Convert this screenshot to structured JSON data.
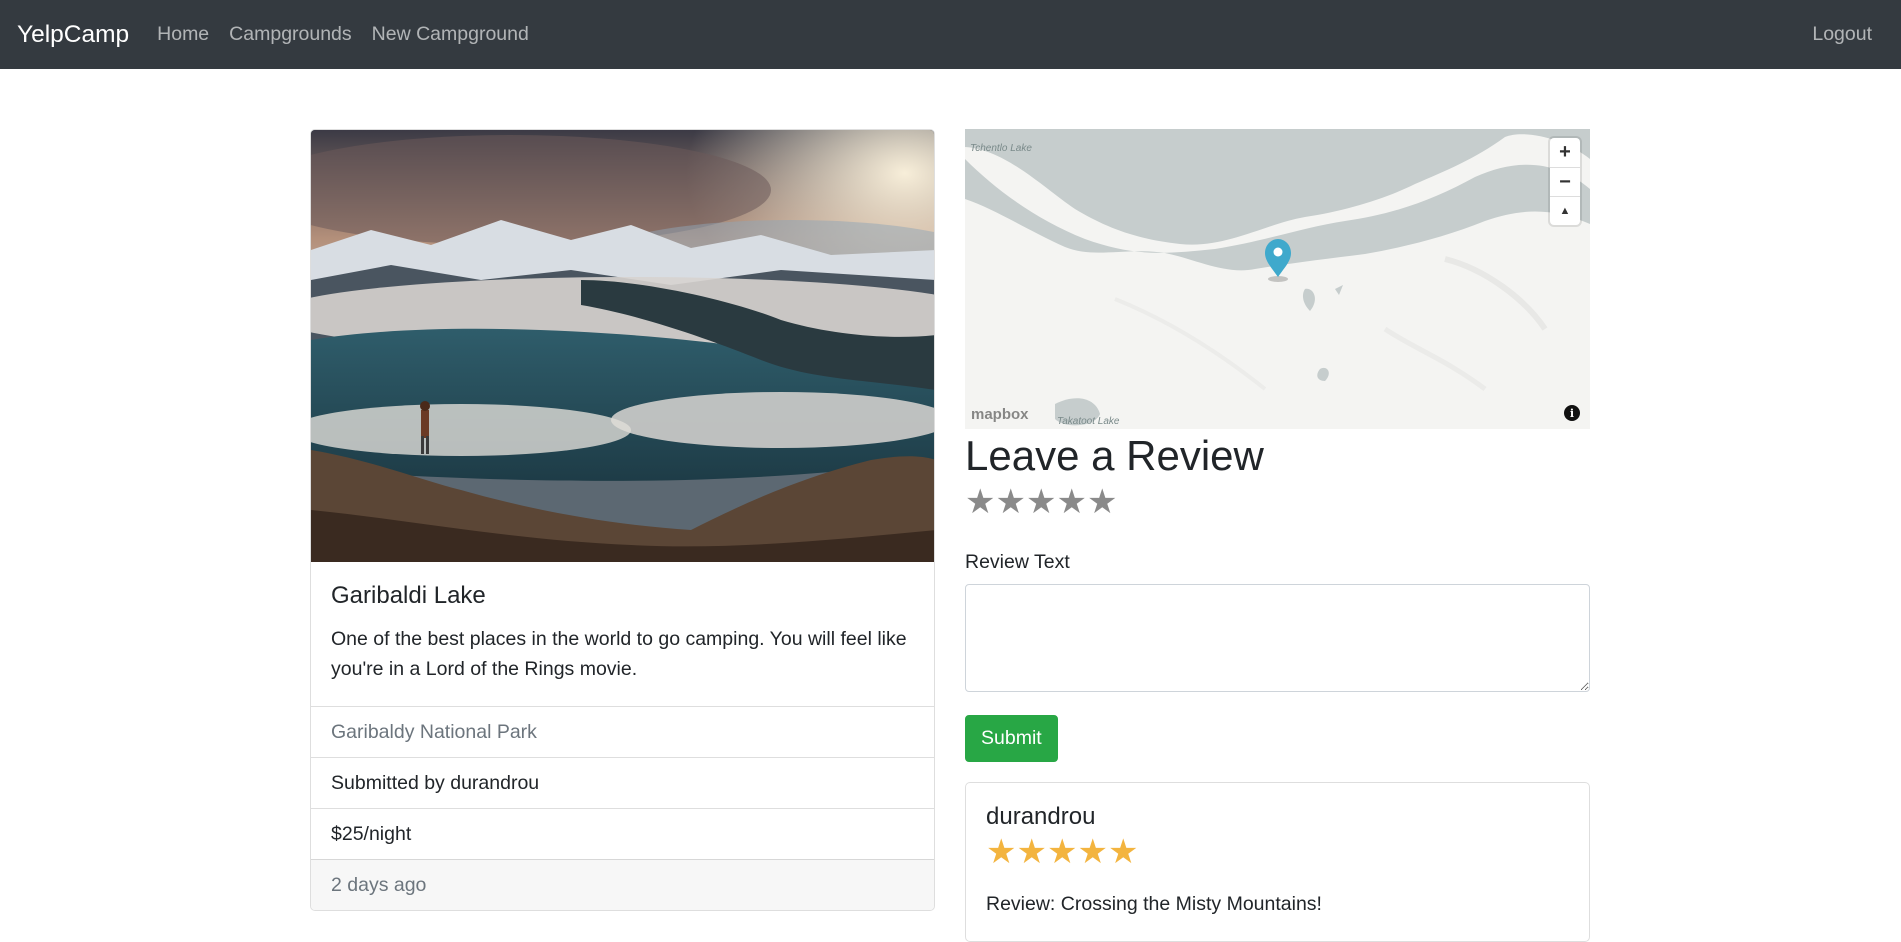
{
  "nav": {
    "brand": "YelpCamp",
    "links": [
      "Home",
      "Campgrounds",
      "New Campground"
    ],
    "logout": "Logout"
  },
  "campground": {
    "title": "Garibaldi Lake",
    "description": "One of the best places in the world to go camping. You will feel like you're in a Lord of the Rings movie.",
    "location": "Garibaldy National Park",
    "submitted_by": "Submitted by durandrou",
    "price": "$25/night",
    "posted": "2 days ago"
  },
  "map": {
    "label_top": "Tchentlo Lake",
    "label_bottom": "Takatoot Lake",
    "logo": "mapbox",
    "zoom_in": "+",
    "zoom_out": "−",
    "compass": "▲",
    "info": "i"
  },
  "review_form": {
    "heading": "Leave a Review",
    "rating": 0,
    "rating_max": 5,
    "label": "Review Text",
    "textarea_value": "",
    "submit": "Submit"
  },
  "reviews": [
    {
      "author": "durandrou",
      "rating": 5,
      "text": "Review: Crossing the Misty Mountains!"
    }
  ],
  "colors": {
    "navbar": "#343a40",
    "submit": "#28a745",
    "star_filled": "#f3b43f",
    "star_empty": "#8a8a8a",
    "map_water": "#c6cdcd",
    "map_pin": "#3fa9cc"
  },
  "icons": {
    "star": "star-icon",
    "map_pin": "map-pin-icon",
    "zoom_in": "plus-icon",
    "zoom_out": "minus-icon",
    "compass": "compass-icon",
    "info": "info-icon"
  }
}
